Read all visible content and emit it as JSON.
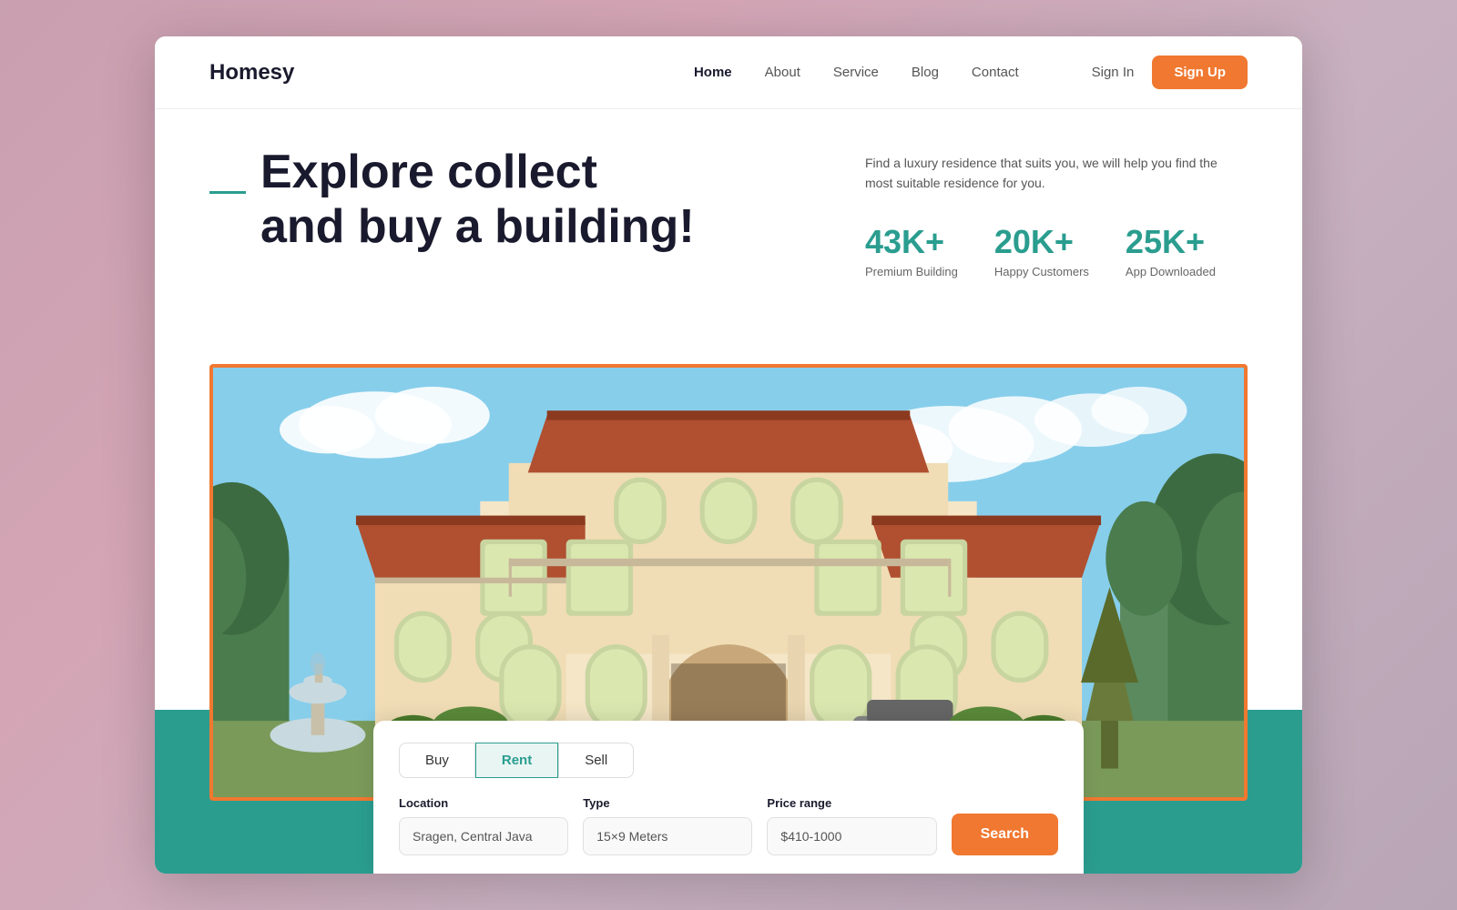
{
  "brand": {
    "logo": "Homesy"
  },
  "nav": {
    "links": [
      {
        "label": "Home",
        "active": true
      },
      {
        "label": "About",
        "active": false
      },
      {
        "label": "Service",
        "active": false
      },
      {
        "label": "Blog",
        "active": false
      },
      {
        "label": "Contact",
        "active": false
      }
    ],
    "sign_in": "Sign In",
    "sign_up": "Sign Up"
  },
  "hero": {
    "title_line1": "Explore collect",
    "title_line2": "and buy a building!",
    "description": "Find a luxury residence that suits you, we will help you find the most suitable residence for you.",
    "stats": [
      {
        "number": "43K+",
        "label": "Premium Building"
      },
      {
        "number": "20K+",
        "label": "Happy Customers"
      },
      {
        "number": "25K+",
        "label": "App Downloaded"
      }
    ]
  },
  "search": {
    "tabs": [
      "Buy",
      "Rent",
      "Sell"
    ],
    "active_tab": "Rent",
    "fields": [
      {
        "label": "Location",
        "value": "Sragen, Central Java"
      },
      {
        "label": "Type",
        "value": "15×9 Meters"
      },
      {
        "label": "Price range",
        "value": "$410-1000"
      }
    ],
    "button_label": "Search"
  },
  "colors": {
    "teal": "#2a9d8f",
    "orange": "#f07830",
    "dark": "#1a1a2e"
  }
}
